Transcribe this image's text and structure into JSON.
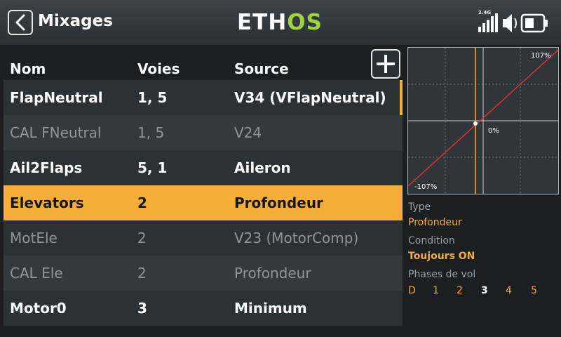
{
  "header": {
    "title": "Mixages",
    "logo_main": "ETH",
    "logo_accent": "OS",
    "band": "2.4G"
  },
  "columns": {
    "name": "Nom",
    "channels": "Voies",
    "source": "Source"
  },
  "rows": [
    {
      "name": "FlapNeutral",
      "channels": "1, 5",
      "source": "V34 (VFlapNeutral)",
      "state": "active"
    },
    {
      "name": "CAL FNeutral",
      "channels": "1, 5",
      "source": "V24",
      "state": "inactive"
    },
    {
      "name": "Ail2Flaps",
      "channels": "5, 1",
      "source": "Aileron",
      "state": "active"
    },
    {
      "name": "Elevators",
      "channels": "2",
      "source": "Profondeur",
      "state": "selected"
    },
    {
      "name": "MotEle",
      "channels": "2",
      "source": "V23 (MotorComp)",
      "state": "inactive"
    },
    {
      "name": "CAL Ele",
      "channels": "2",
      "source": "Profondeur",
      "state": "inactive"
    },
    {
      "name": "Motor0",
      "channels": "3",
      "source": "Minimum",
      "state": "active"
    }
  ],
  "curve": {
    "max_label": "107%",
    "mid_label": "0%",
    "min_label": "-107%"
  },
  "details": {
    "type_label": "Type",
    "type_value": "Profondeur",
    "condition_label": "Condition",
    "condition_value": "Toujours ON",
    "phases_label": "Phases de vol",
    "phases": [
      "D",
      "1",
      "2",
      "3",
      "4",
      "5"
    ],
    "current_phase": "3"
  },
  "colors": {
    "accent": "#f5ae37",
    "logo_accent": "#9fd23f",
    "curve_line": "#e03030"
  }
}
